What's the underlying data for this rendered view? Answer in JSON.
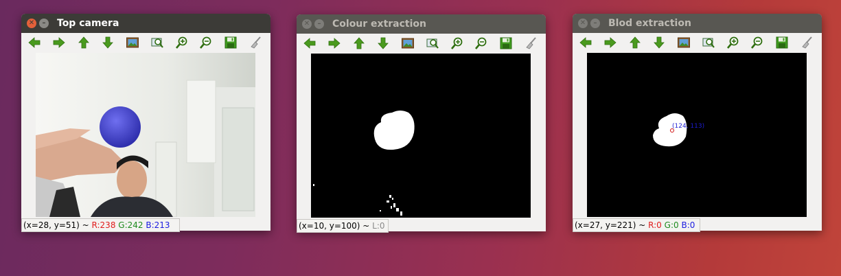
{
  "windows": [
    {
      "title": "Top camera",
      "state": "active",
      "status": {
        "coords": "(x=28, y=51) ~ ",
        "r": "R:238",
        "g": "G:242",
        "b": "B:213"
      }
    },
    {
      "title": "Colour extraction",
      "state": "inactive",
      "status": {
        "coords": "(x=10, y=100) ~ ",
        "l": "L:0"
      }
    },
    {
      "title": "Blod extraction",
      "state": "inactive",
      "status": {
        "coords": "(x=27, y=221) ~ ",
        "r": "R:0",
        "g": "G:0",
        "b": "B:0"
      },
      "blob_label": "(124, 113)"
    }
  ],
  "toolbar_icons": [
    "arrow-left-icon",
    "arrow-right-icon",
    "arrow-up-icon",
    "arrow-down-icon",
    "image-icon",
    "zoom-fit-icon",
    "zoom-in-icon",
    "zoom-out-icon",
    "save-icon",
    "clear-icon"
  ],
  "colors": {
    "desktop_accent": "#b43a3a",
    "titlebar": "#3c3b37",
    "arrow_green": "#4a9a1e",
    "close_orange": "#e3603a"
  }
}
